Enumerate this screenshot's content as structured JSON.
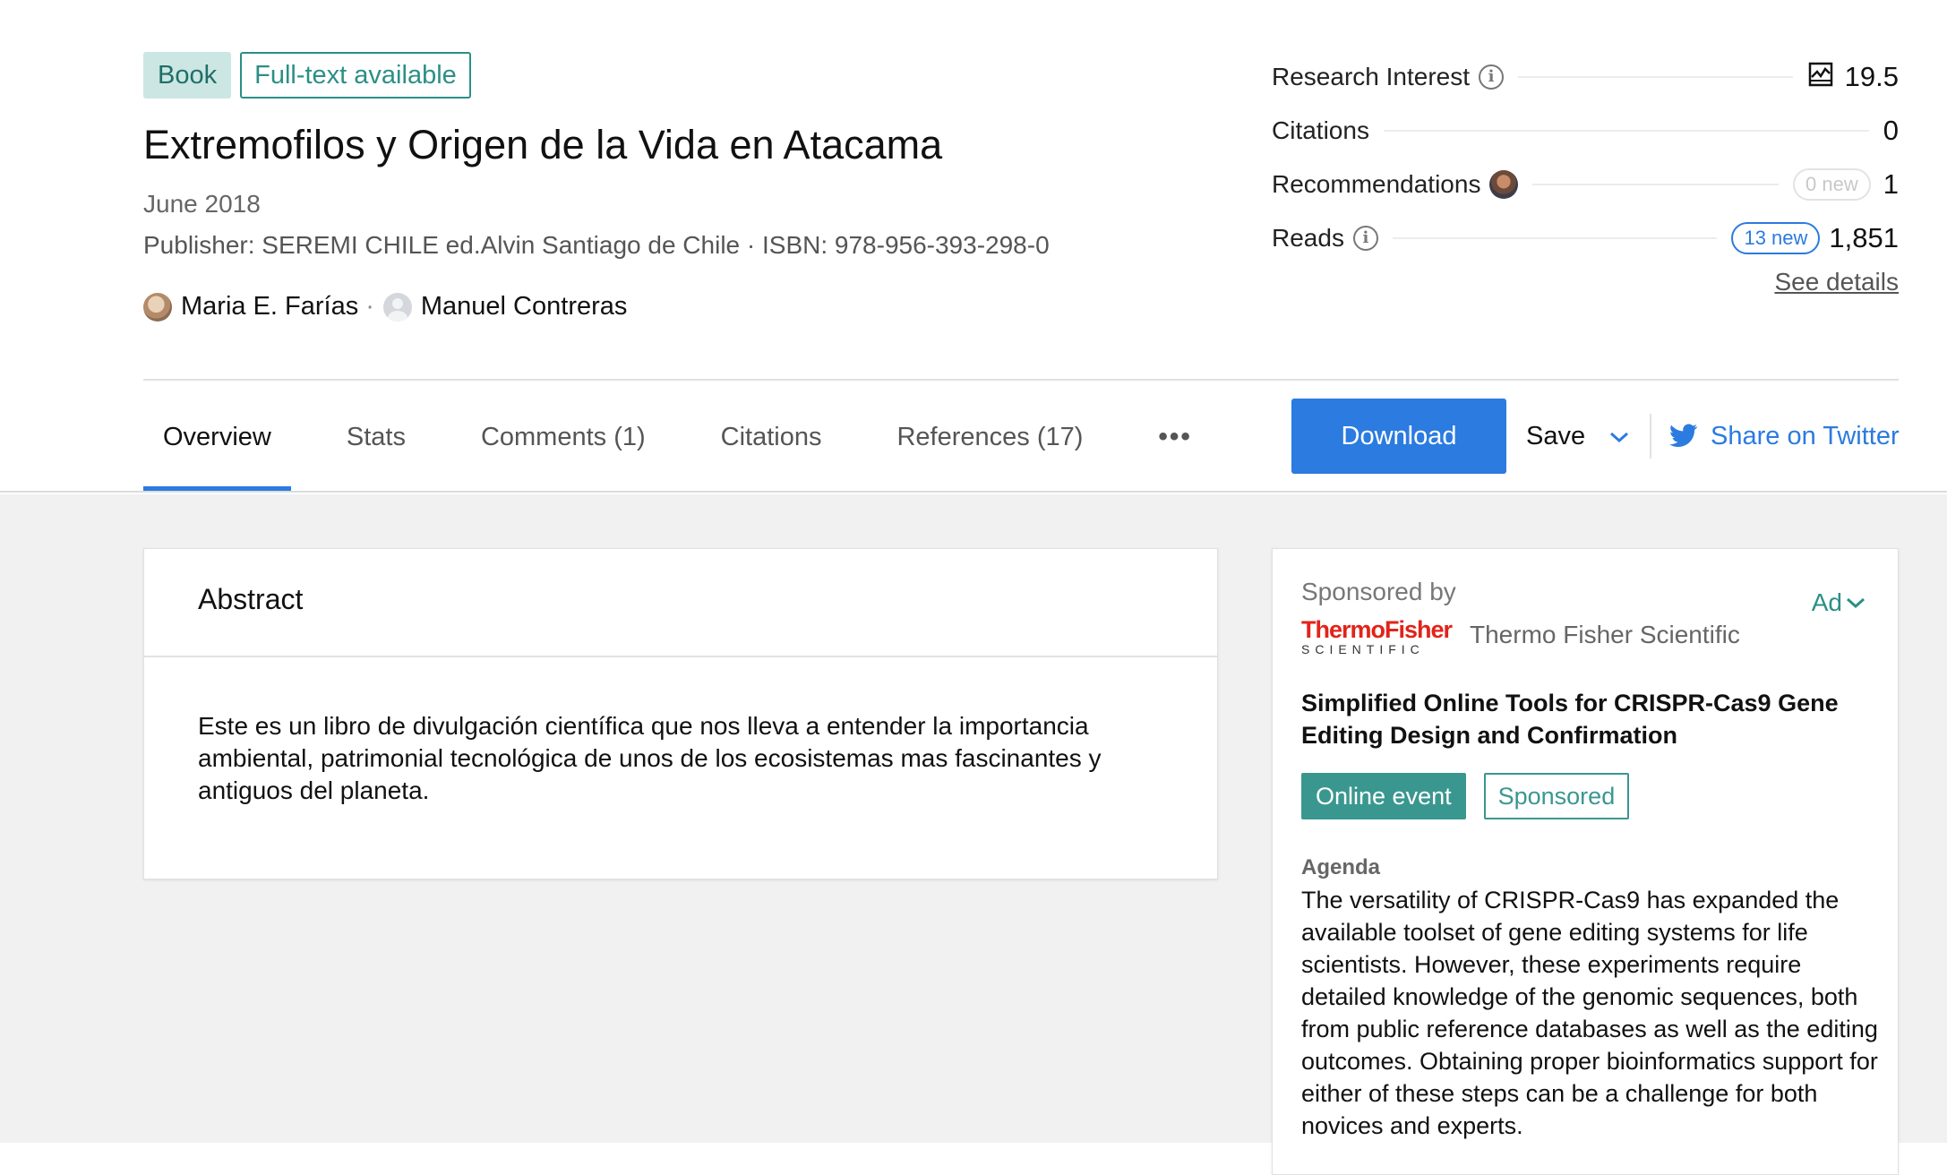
{
  "header": {
    "badges": {
      "book": "Book",
      "fulltext": "Full-text available"
    },
    "title": "Extremofilos y Origen de la Vida en Atacama",
    "date": "June 2018",
    "publisher": "Publisher: SEREMI CHILE ed.Alvin Santiago de Chile · ISBN: 978-956-393-298-0",
    "authors": [
      {
        "name": "Maria E. Farías",
        "avatar": "photo"
      },
      {
        "name": "Manuel Contreras",
        "avatar": "placeholder"
      }
    ],
    "author_separator": "·"
  },
  "stats": {
    "research_interest": {
      "label": "Research Interest",
      "value": "19.5",
      "icon": "research-interest-icon"
    },
    "citations": {
      "label": "Citations",
      "value": "0"
    },
    "recommendations": {
      "label": "Recommendations",
      "new": "0 new",
      "value": "1"
    },
    "reads": {
      "label": "Reads",
      "new": "13 new",
      "value": "1,851"
    },
    "see_details": "See details"
  },
  "nav": {
    "tabs": [
      {
        "label": "Overview",
        "active": true
      },
      {
        "label": "Stats",
        "active": false
      },
      {
        "label": "Comments (1)",
        "active": false
      },
      {
        "label": "Citations",
        "active": false
      },
      {
        "label": "References (17)",
        "active": false
      }
    ],
    "more": "•••",
    "download": "Download",
    "save": "Save",
    "share_twitter": "Share on Twitter"
  },
  "abstract": {
    "heading": "Abstract",
    "text": "Este es un libro de divulgación científica que nos lleva a entender la importancia ambiental, patrimonial tecnológica de unos de los ecosistemas mas fascinantes y antiguos del planeta."
  },
  "ad": {
    "sponsored_by": "Sponsored by",
    "toggle": "Ad",
    "logo_main": "ThermoFisher",
    "logo_sub": "SCIENTIFIC",
    "sponsor_name": "Thermo Fisher Scientific",
    "title": "Simplified Online Tools for CRISPR-Cas9 Gene Editing Design and Confirmation",
    "tags": {
      "online": "Online event",
      "sponsored": "Sponsored"
    },
    "agenda_label": "Agenda",
    "agenda_text": "The versatility of CRISPR-Cas9 has expanded the available toolset of gene editing systems for life scientists. However, these experiments require detailed knowledge of the genomic sequences, both from public reference databases as well as the editing outcomes. Obtaining proper bioinformatics support for either of these steps can be a challenge for both novices and experts."
  },
  "colors": {
    "accent_blue": "#2b7be0",
    "teal": "#2b8f86",
    "thermo_red": "#e2231a",
    "body_bg": "#f1f1f1"
  }
}
